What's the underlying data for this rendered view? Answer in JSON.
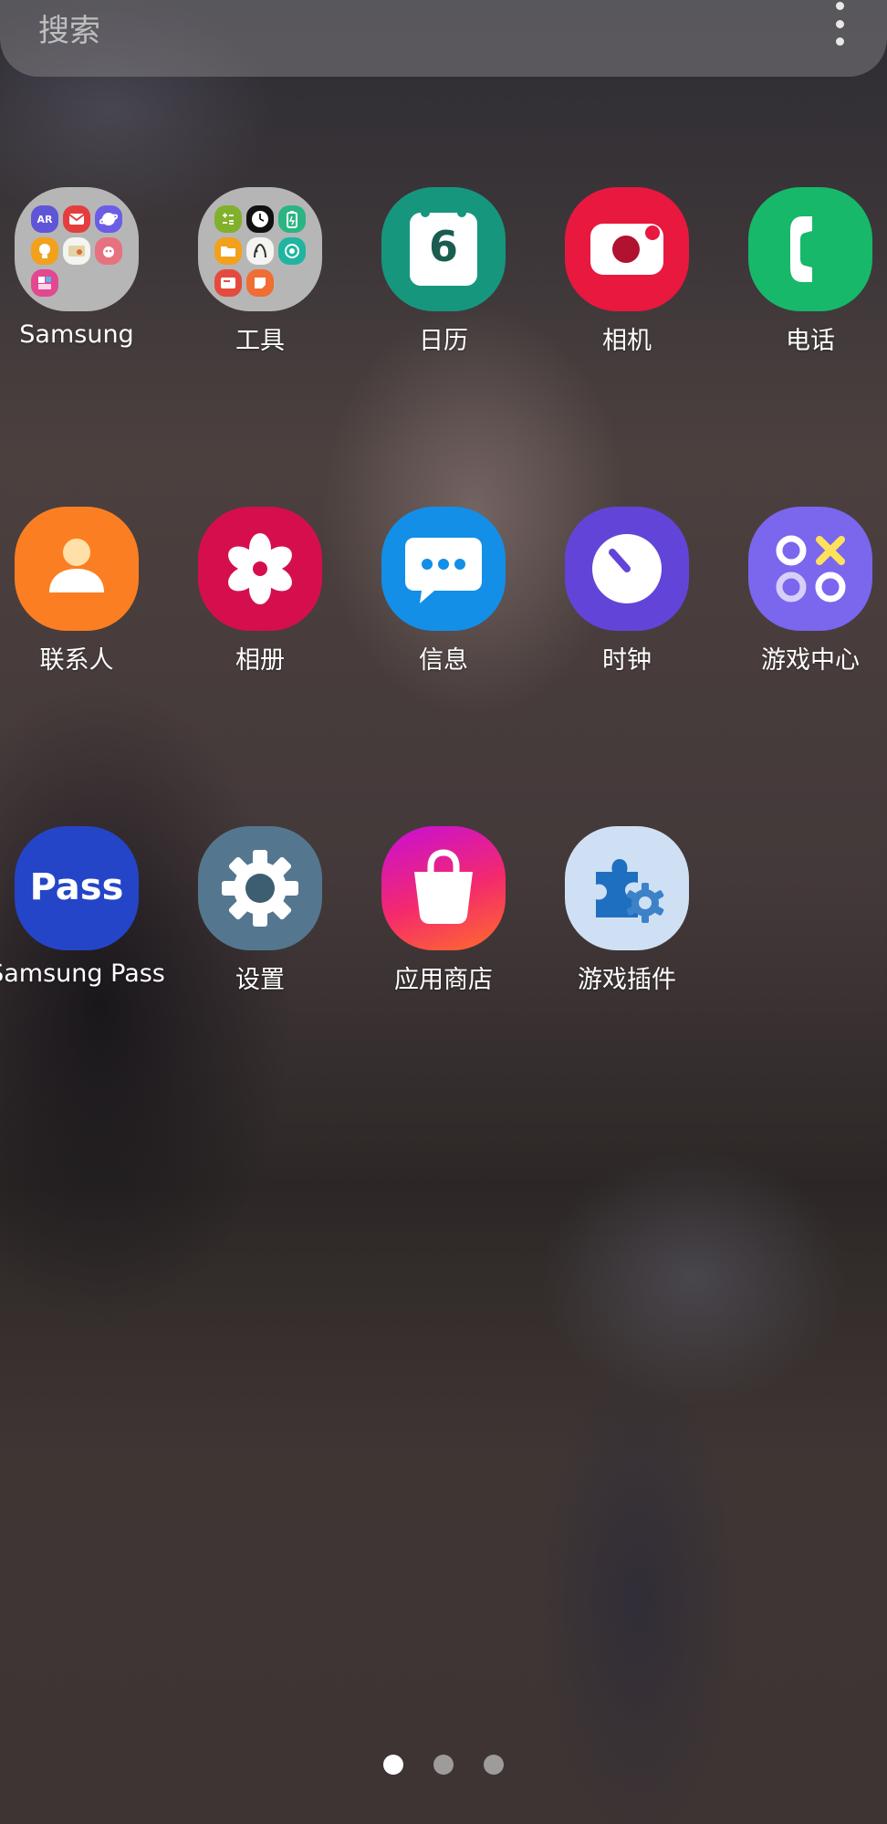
{
  "search": {
    "placeholder": "搜索"
  },
  "apps": [
    {
      "label": "Samsung"
    },
    {
      "label": "工具"
    },
    {
      "label": "日历",
      "date": "6"
    },
    {
      "label": "相机"
    },
    {
      "label": "电话"
    },
    {
      "label": "联系人"
    },
    {
      "label": "相册"
    },
    {
      "label": "信息"
    },
    {
      "label": "时钟"
    },
    {
      "label": "游戏中心"
    },
    {
      "label": "Samsung Pass",
      "icon_text": "Pass"
    },
    {
      "label": "设置"
    },
    {
      "label": "应用商店"
    },
    {
      "label": "游戏插件"
    }
  ],
  "samsung_folder": {
    "ar_badge": "AR"
  },
  "pages": {
    "count": 3,
    "active": 0
  },
  "colors": {
    "calendar": "#17967e",
    "camera": "#e8183f",
    "phone": "#17b86a",
    "contacts": "#fb7f22",
    "gallery": "#d50f4d",
    "messages": "#138fe8",
    "clock": "#6245d8",
    "game_center": "#7b66ee",
    "pass": "#2545c8",
    "settings": "#54778f",
    "store_start": "#c70ed8",
    "store_end": "#ff6d2b",
    "game_plugins": "#cfe0f4"
  }
}
